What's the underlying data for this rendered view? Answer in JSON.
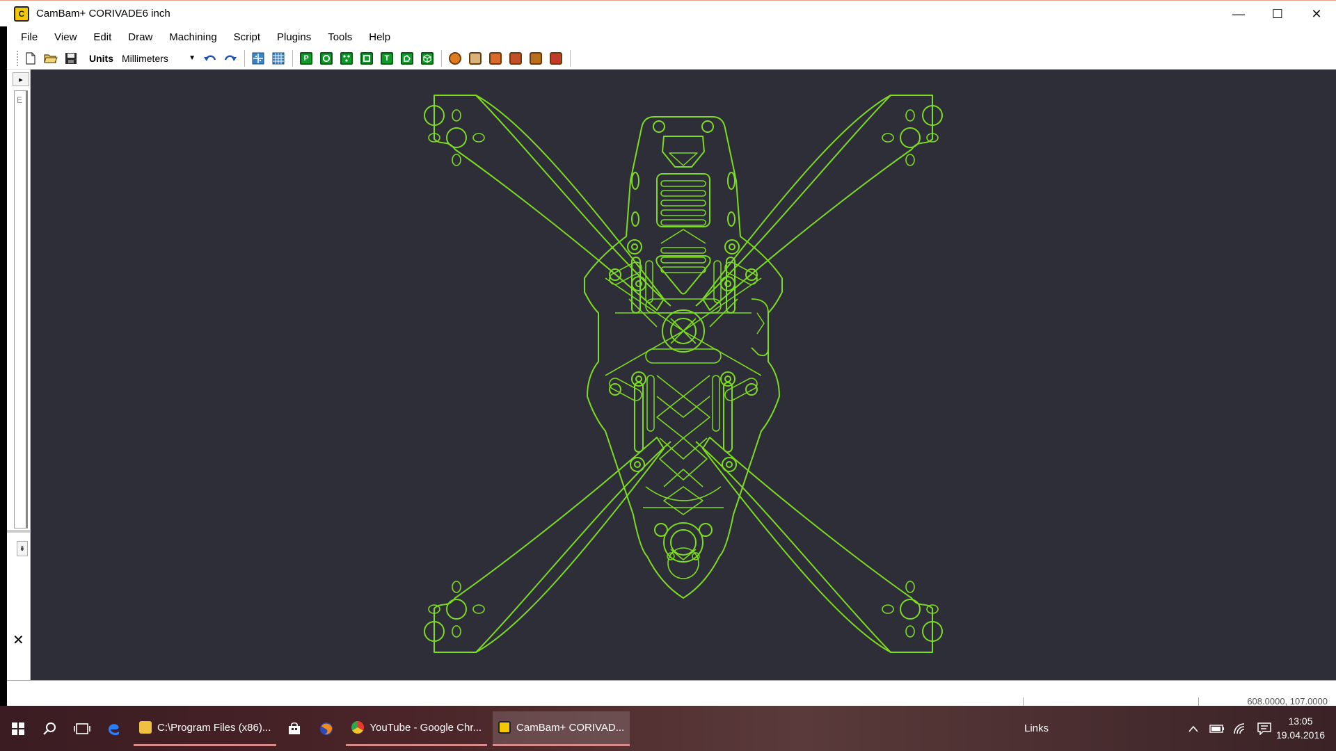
{
  "window": {
    "app_icon_glyph": "C",
    "title": "CamBam+  CORIVADE6 inch",
    "minimize_glyph": "—",
    "maximize_glyph": "☐",
    "close_glyph": "✕"
  },
  "menu": [
    "File",
    "View",
    "Edit",
    "Draw",
    "Machining",
    "Script",
    "Plugins",
    "Tools",
    "Help"
  ],
  "toolbar": {
    "units_label": "Units",
    "units_value": "Millimeters",
    "icons": [
      "new-file-icon",
      "open-folder-icon",
      "save-icon",
      "undo-icon",
      "redo-icon",
      "snap-grid-icon",
      "show-grid-icon",
      "polyline-icon",
      "circle-icon",
      "points-icon",
      "rectangle-icon",
      "text-icon",
      "region-icon",
      "cube-icon",
      "profile-op-icon",
      "pocket-op-icon",
      "drill-op-icon",
      "engrave-op-icon",
      "3d-op-icon",
      "gcode-icon"
    ],
    "text_icon_letter": "T",
    "polyline_icon_letter": "P"
  },
  "leftpanel": {
    "expand_glyph": "▸",
    "tree_letter": "E",
    "scroll_glyph": "⇟",
    "close_glyph": "✕"
  },
  "statusbar": {
    "coords": "608.0000, 107.0000"
  },
  "taskbar": {
    "tasks": [
      {
        "label": "C:\\Program Files (x86)...",
        "icon": "folder-icon",
        "active": false
      },
      {
        "label": "YouTube - Google Chr...",
        "icon": "chrome-icon",
        "active": false
      },
      {
        "label": "CamBam+  CORIVAD...",
        "icon": "cambam-icon",
        "active": true
      }
    ],
    "links_label": "Links",
    "time": "13:05",
    "date": "19.04.2016"
  },
  "colors": {
    "canvas_bg": "#2d2e38",
    "drawing_stroke": "#7ddc1f",
    "toolbar_green": "#0c9b2a",
    "toolbar_orange": "#e07a1c"
  }
}
